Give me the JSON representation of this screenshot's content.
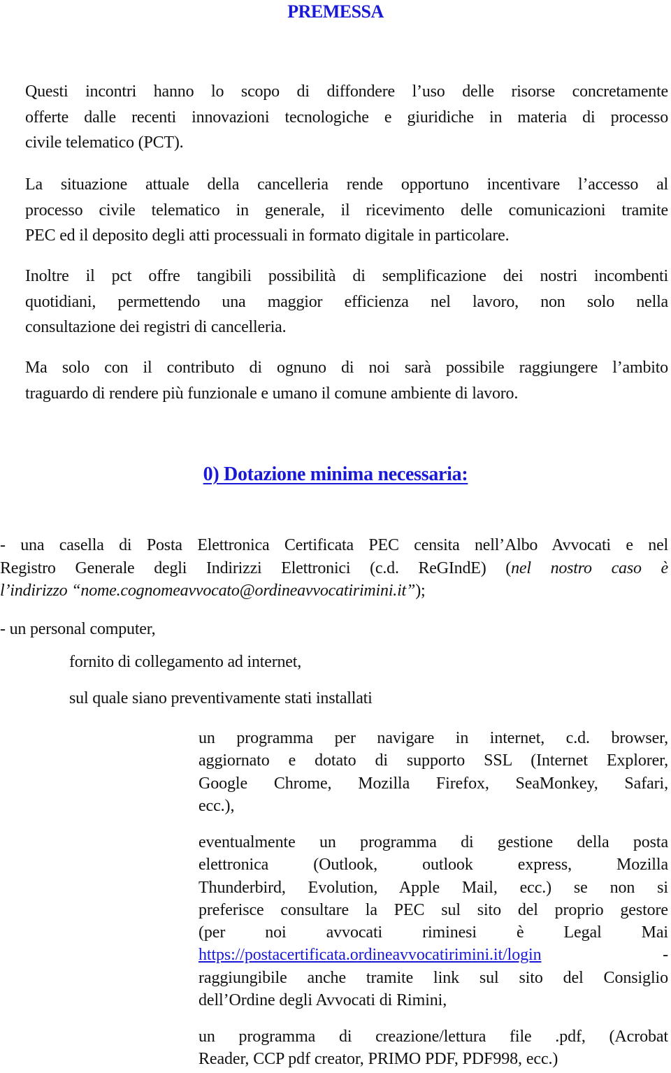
{
  "document": {
    "title": "PREMESSA",
    "intro_paragraphs": [
      {
        "lines": [
          "Questi incontri hanno lo scopo di diffondere l’uso delle risorse  concretamente",
          "offerte dalle recenti innovazioni tecnologiche e giuridiche in materia di processo",
          "civile telematico (PCT)."
        ]
      },
      {
        "lines": [
          "La situazione attuale della cancelleria rende opportuno incentivare l’accesso al",
          "processo civile telematico in generale, il ricevimento delle comunicazioni tramite",
          "PEC ed il deposito degli atti processuali in formato digitale in particolare."
        ]
      },
      {
        "lines": [
          "Inoltre il pct offre tangibili possibilità di semplificazione dei nostri incombenti",
          "quotidiani, permettendo una maggior efficienza nel lavoro, non solo nella",
          "consultazione dei registri di cancelleria."
        ]
      },
      {
        "lines": [
          "Ma solo con il contributo di ognuno di noi sarà possibile raggiungere l’ambito",
          "traguardo di rendere più funzionale e umano il comune ambiente di lavoro."
        ]
      }
    ],
    "section_heading": "0) Dotazione minima necessaria:",
    "bullet_pec": {
      "line1": "- una casella di Posta Elettronica Certificata PEC censita nell’Albo Avvocati e nel",
      "line2_plain": "Registro Generale degli Indirizzi Elettronici (c.d. ReGIndE)  (",
      "line2_italic": "nel nostro caso è",
      "line3_italic": "l’indirizzo “nome.cognomeavvocato@ordineavvocatirimini.it”",
      "line3_plain": ");"
    },
    "bullet_pc": "- un personal computer,",
    "sub_items": [
      "fornito di collegamento ad internet,",
      "sul quale siano preventivamente stati installati"
    ],
    "software": {
      "browser": {
        "lines": [
          "un programma per navigare in internet, c.d. browser,",
          "aggiornato e dotato di supporto SSL (Internet Explorer,",
          "Google Chrome, Mozilla Firefox, SeaMonkey, Safari,",
          "ecc.),"
        ]
      },
      "mail_client": {
        "lines": [
          "eventualmente un programma di gestione della posta",
          "elettronica (Outlook, outlook express, Mozilla",
          "Thunderbird, Evolution, Apple Mail, ecc.) se non si",
          "preferisce consultare la PEC sul sito del proprio gestore",
          "(per noi avvocati riminesi è Legal Mai"
        ],
        "link": "https://postacertificata.ordineavvocatirimini.it/login",
        "link_suffix": "-",
        "after_lines": [
          "raggiungibile anche tramite link sul sito del Consiglio",
          "dell’Ordine degli Avvocati di Rimini,"
        ]
      },
      "pdf": {
        "lines": [
          "un programma di creazione/lettura file .pdf, (Acrobat",
          "Reader, CCP pdf creator, PRIMO PDF, PDF998, ecc.)"
        ]
      }
    },
    "colors": {
      "heading": "#1a1ad6",
      "text": "#111111",
      "link": "#1a1ad6"
    }
  }
}
